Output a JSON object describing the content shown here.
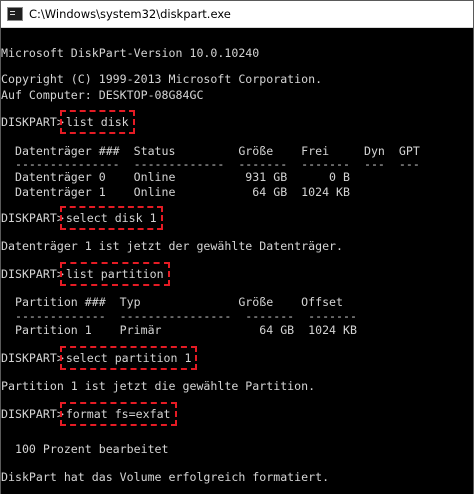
{
  "window": {
    "title": "C:\\Windows\\system32\\diskpart.exe",
    "icon": "console-icon"
  },
  "console": {
    "version_line": "Microsoft DiskPart-Version 10.0.10240",
    "copyright_line": "Copyright (C) 1999-2013 Microsoft Corporation.",
    "computer_line": "Auf Computer: DESKTOP-08G84GC",
    "prompt": "DISKPART>",
    "commands": [
      "list disk",
      "select disk 1",
      "list partition",
      "select partition 1",
      "format fs=exfat"
    ],
    "disk_table": {
      "header": "  Datenträger ###  Status         Größe    Frei     Dyn  GPT",
      "separator": "  ---------------  -------------  -------  -------  ---  ---",
      "rows": [
        "  Datenträger 0    Online          931 GB      0 B",
        "  Datenträger 1    Online           64 GB  1024 KB"
      ]
    },
    "select_disk_result": "Datenträger 1 ist jetzt der gewählte Datenträger.",
    "partition_table": {
      "header": "  Partition ###  Typ              Größe    Offset",
      "separator": "  -------------  ----------------  -------  -------",
      "rows": [
        "  Partition 1    Primär              64 GB  1024 KB"
      ]
    },
    "select_partition_result": "Partition 1 ist jetzt die gewählte Partition.",
    "format_progress": "  100 Prozent bearbeitet",
    "format_result": "DiskPart hat das Volume erfolgreich formatiert."
  },
  "colors": {
    "background": "#000000",
    "text": "#d4d4d4",
    "highlight": "#e51b24"
  }
}
